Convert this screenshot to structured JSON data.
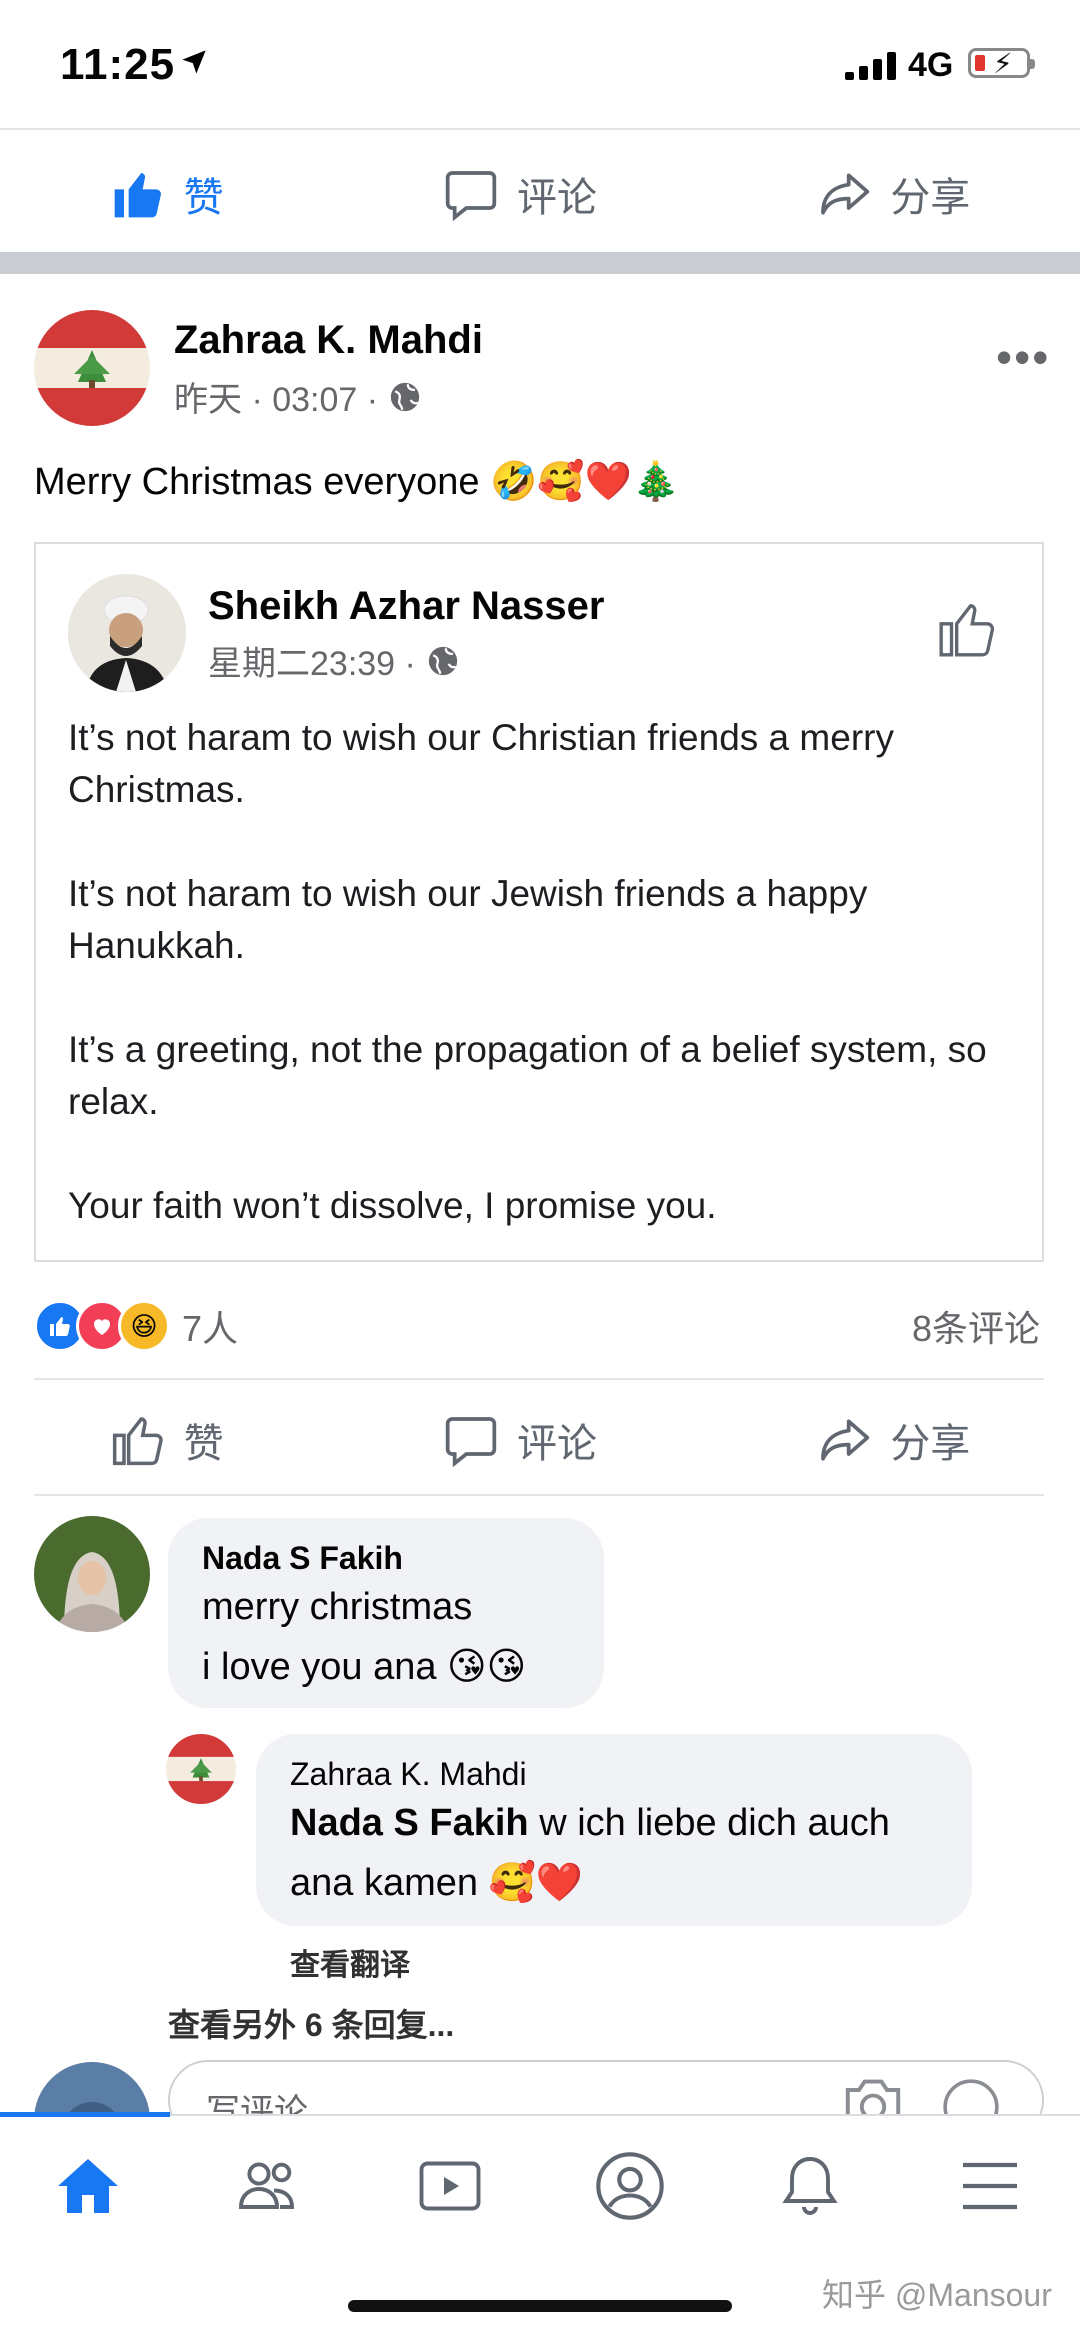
{
  "status_bar": {
    "time": "11:25",
    "network": "4G",
    "icons": [
      "location-arrow-icon",
      "signal-icon",
      "battery-low-charging-icon"
    ]
  },
  "top_actions": {
    "like": "赞",
    "comment": "评论",
    "share": "分享",
    "like_color": "#1877f2"
  },
  "post": {
    "author": "Zahraa K. Mahdi",
    "time": "昨天 · 03:07 ·",
    "text": "Merry Christmas everyone 🤣🥰❤️🎄",
    "shared": {
      "author": "Sheikh Azhar Nasser",
      "time": "星期二23:39 ·",
      "paragraphs": [
        "It’s not haram to wish our Christian friends a merry Christmas.",
        "It’s not haram to wish our Jewish friends a happy Hanukkah.",
        "It’s a greeting, not the propagation of a belief system, so relax.",
        "Your faith won’t dissolve, I promise you."
      ]
    },
    "reaction_count": "7人",
    "comment_count": "8条评论"
  },
  "bottom_actions": {
    "like": "赞",
    "comment": "评论",
    "share": "分享"
  },
  "comments": [
    {
      "author": "Nada S Fakih",
      "line1": "merry christmas",
      "line2": "i love you ana 😘😘"
    },
    {
      "author": "Zahraa K. Mahdi",
      "mention": "Nada S Fakih",
      "line1_rest": " w ich liebe dich auch",
      "line2": "ana kamen 🥰❤️",
      "translate": "查看翻译"
    }
  ],
  "more_replies": "查看另外 6 条回复...",
  "composer": {
    "placeholder": "写评论..."
  },
  "tabs": [
    "home-icon",
    "friends-icon",
    "watch-icon",
    "profile-icon",
    "notifications-icon",
    "menu-icon"
  ],
  "watermark": "知乎 @Mansour"
}
